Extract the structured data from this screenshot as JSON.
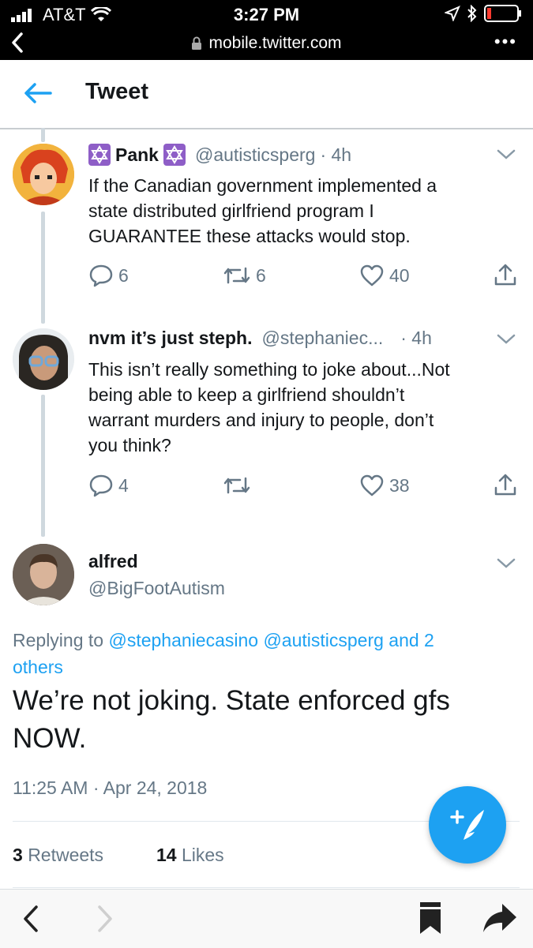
{
  "status_bar": {
    "carrier": "AT&T",
    "time": "3:27 PM",
    "url": "mobile.twitter.com",
    "more": "•••"
  },
  "header": {
    "title": "Tweet"
  },
  "tweets": [
    {
      "name": "Pank",
      "handle": "@autisticsperg",
      "time": "· 4h",
      "text_lines": [
        "If the Canadian government implemented a",
        "state distributed girlfriend program I",
        "GUARANTEE these attacks would stop."
      ],
      "replies": "6",
      "retweets": "6",
      "likes": "40"
    },
    {
      "name": "nvm it’s just steph.",
      "handle": "@stephaniec...",
      "time": "· 4h",
      "text_lines": [
        "This isn’t really something to joke about...Not",
        "being able to keep a girlfriend shouldn’t",
        "warrant murders and injury to people, don’t",
        "you think?"
      ],
      "replies": "4",
      "retweets": "",
      "likes": "38"
    }
  ],
  "main_tweet": {
    "name": "alfred",
    "handle": "@BigFootAutism",
    "replying_prefix": "Replying to",
    "replying_links": "@stephaniecasino @autisticsperg",
    "replying_and": "and 2",
    "replying_others": "others",
    "text_line1": "We’re not joking. State enforced gfs",
    "text_line2": "NOW.",
    "timestamp": "11:25 AM · Apr 24, 2018",
    "retweet_count": "3",
    "retweet_label": "Retweets",
    "like_count": "14",
    "like_label": "Likes"
  },
  "colors": {
    "accent": "#1da1f2",
    "muted": "#657786",
    "text": "#14171a"
  }
}
